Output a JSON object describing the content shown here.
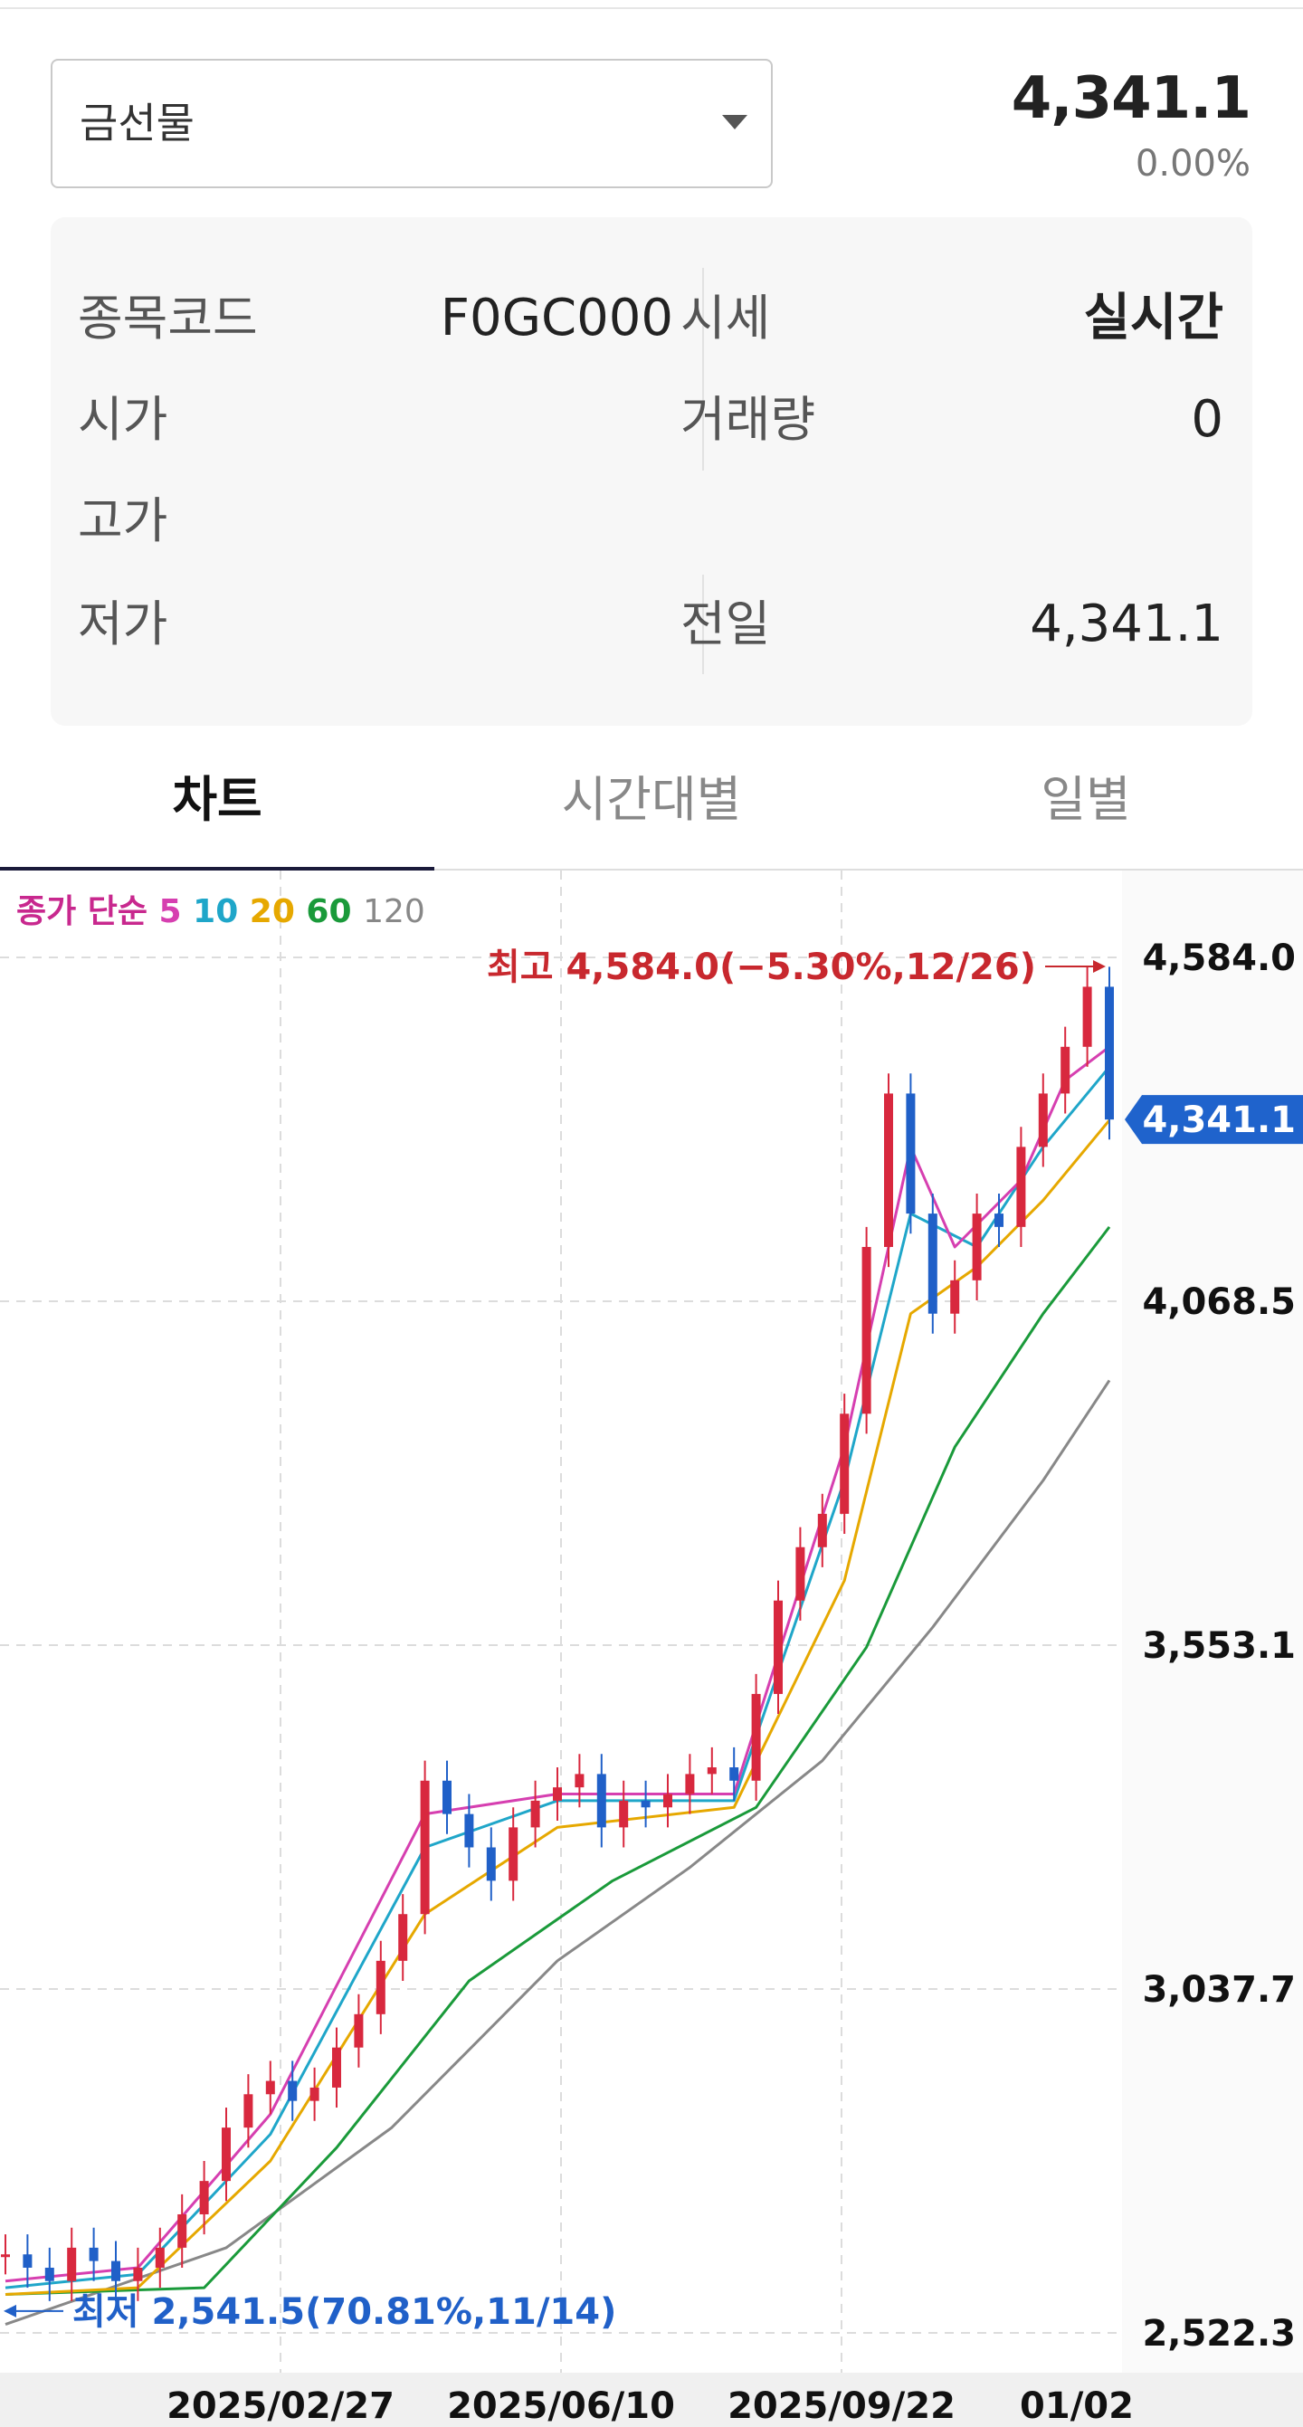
{
  "selector": {
    "label": "금선물"
  },
  "quote": {
    "price": "4,341.1",
    "change": "0.00%"
  },
  "info": {
    "code_label": "종목코드",
    "code_value": "F0GC000",
    "quote_label": "시세",
    "quote_value": "실시간",
    "open_label": "시가",
    "volume_label": "거래량",
    "volume_value": "0",
    "high_label": "고가",
    "low_label": "저가",
    "prev_label": "전일",
    "prev_value": "4,341.1"
  },
  "tabs": [
    {
      "label": "차트",
      "active": true
    },
    {
      "label": "시간대별",
      "active": false
    },
    {
      "label": "일별",
      "active": false
    }
  ],
  "legend": {
    "prefix": "종가 단순",
    "items": [
      {
        "label": "5",
        "color": "#d63fb0"
      },
      {
        "label": "10",
        "color": "#1fa6c9"
      },
      {
        "label": "20",
        "color": "#e6a800"
      },
      {
        "label": "60",
        "color": "#1a9a3a"
      },
      {
        "label": "120",
        "color": "#888888"
      }
    ]
  },
  "colors": {
    "up": "#d8283e",
    "down": "#2060c8",
    "current_tag": "#1f63cc"
  },
  "chart_data": {
    "type": "line",
    "x_ticks": [
      "2025/02/27",
      "2025/06/10",
      "2025/09/22",
      "01/02"
    ],
    "y_ticks": [
      4584.0,
      4068.5,
      3553.1,
      3037.7,
      2522.3
    ],
    "y_tick_labels": [
      "4,584.0",
      "4,068.5",
      "3,553.1",
      "3,037.7",
      "2,522.3"
    ],
    "ylim": [
      2522.3,
      4584.0
    ],
    "current_value": 4341.1,
    "current_label": "4,341.1",
    "high_annotation": "최고 4,584.0(−5.30%,12/26)",
    "low_annotation": "최저 2,541.5(70.81%,11/14)",
    "series": [
      {
        "name": "5",
        "approx_path": [
          [
            0,
            2600
          ],
          [
            0.12,
            2620
          ],
          [
            0.24,
            2850
          ],
          [
            0.38,
            3300
          ],
          [
            0.5,
            3330
          ],
          [
            0.66,
            3330
          ],
          [
            0.76,
            3850
          ],
          [
            0.82,
            4300
          ],
          [
            0.86,
            4150
          ],
          [
            0.92,
            4250
          ],
          [
            0.96,
            4400
          ],
          [
            1.0,
            4450
          ]
        ]
      },
      {
        "name": "10",
        "approx_path": [
          [
            0,
            2590
          ],
          [
            0.12,
            2610
          ],
          [
            0.24,
            2820
          ],
          [
            0.38,
            3250
          ],
          [
            0.5,
            3320
          ],
          [
            0.66,
            3320
          ],
          [
            0.76,
            3800
          ],
          [
            0.82,
            4200
          ],
          [
            0.88,
            4150
          ],
          [
            0.94,
            4300
          ],
          [
            1.0,
            4420
          ]
        ]
      },
      {
        "name": "20",
        "approx_path": [
          [
            0,
            2580
          ],
          [
            0.12,
            2590
          ],
          [
            0.24,
            2780
          ],
          [
            0.38,
            3150
          ],
          [
            0.5,
            3280
          ],
          [
            0.66,
            3310
          ],
          [
            0.76,
            3650
          ],
          [
            0.82,
            4050
          ],
          [
            0.88,
            4120
          ],
          [
            0.94,
            4220
          ],
          [
            1.0,
            4340
          ]
        ]
      },
      {
        "name": "60",
        "approx_path": [
          [
            0,
            2580
          ],
          [
            0.18,
            2590
          ],
          [
            0.3,
            2800
          ],
          [
            0.42,
            3050
          ],
          [
            0.55,
            3200
          ],
          [
            0.68,
            3310
          ],
          [
            0.78,
            3550
          ],
          [
            0.86,
            3850
          ],
          [
            0.94,
            4050
          ],
          [
            1.0,
            4180
          ]
        ]
      },
      {
        "name": "120",
        "approx_path": [
          [
            0,
            2535
          ],
          [
            0.2,
            2650
          ],
          [
            0.35,
            2830
          ],
          [
            0.5,
            3080
          ],
          [
            0.62,
            3220
          ],
          [
            0.74,
            3380
          ],
          [
            0.84,
            3580
          ],
          [
            0.94,
            3800
          ],
          [
            1.0,
            3950
          ]
        ]
      }
    ],
    "candles_close_approx": [
      [
        0.0,
        2640
      ],
      [
        0.02,
        2620
      ],
      [
        0.04,
        2600
      ],
      [
        0.06,
        2650
      ],
      [
        0.08,
        2630
      ],
      [
        0.1,
        2600
      ],
      [
        0.12,
        2620
      ],
      [
        0.14,
        2650
      ],
      [
        0.16,
        2700
      ],
      [
        0.18,
        2750
      ],
      [
        0.2,
        2830
      ],
      [
        0.22,
        2880
      ],
      [
        0.24,
        2900
      ],
      [
        0.26,
        2870
      ],
      [
        0.28,
        2890
      ],
      [
        0.3,
        2950
      ],
      [
        0.32,
        3000
      ],
      [
        0.34,
        3080
      ],
      [
        0.36,
        3150
      ],
      [
        0.38,
        3350
      ],
      [
        0.4,
        3300
      ],
      [
        0.42,
        3250
      ],
      [
        0.44,
        3200
      ],
      [
        0.46,
        3280
      ],
      [
        0.48,
        3320
      ],
      [
        0.5,
        3340
      ],
      [
        0.52,
        3360
      ],
      [
        0.54,
        3280
      ],
      [
        0.56,
        3320
      ],
      [
        0.58,
        3310
      ],
      [
        0.6,
        3330
      ],
      [
        0.62,
        3360
      ],
      [
        0.64,
        3370
      ],
      [
        0.66,
        3350
      ],
      [
        0.68,
        3480
      ],
      [
        0.7,
        3620
      ],
      [
        0.72,
        3700
      ],
      [
        0.74,
        3750
      ],
      [
        0.76,
        3900
      ],
      [
        0.78,
        4150
      ],
      [
        0.8,
        4380
      ],
      [
        0.82,
        4200
      ],
      [
        0.84,
        4050
      ],
      [
        0.86,
        4100
      ],
      [
        0.88,
        4200
      ],
      [
        0.9,
        4180
      ],
      [
        0.92,
        4300
      ],
      [
        0.94,
        4380
      ],
      [
        0.96,
        4450
      ],
      [
        0.98,
        4540
      ],
      [
        1.0,
        4341
      ]
    ]
  }
}
